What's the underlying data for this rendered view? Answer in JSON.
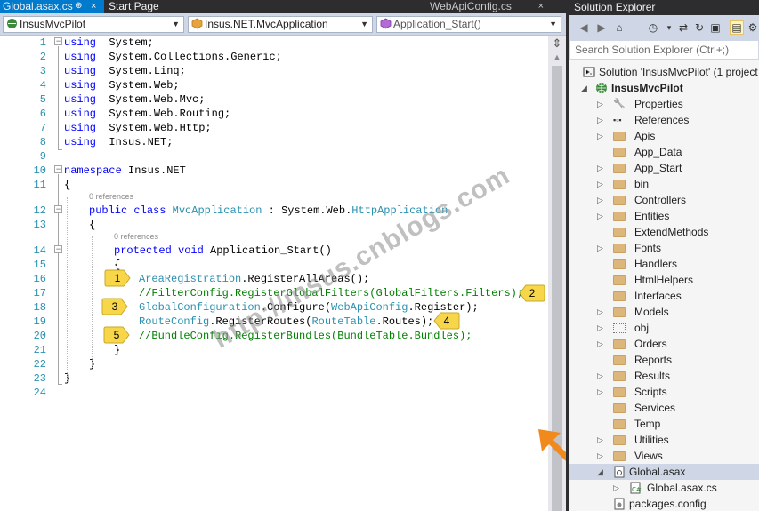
{
  "tabs": {
    "active": "Global.asax.cs",
    "active_pin": "⊕",
    "active_close": "×",
    "second": "Start Page",
    "right": "WebApiConfig.cs",
    "right_close": "×"
  },
  "nav": {
    "project": "InsusMvcPilot",
    "class": "Insus.NET.MvcApplication",
    "member": "Application_Start()"
  },
  "code": {
    "lines": [
      {
        "n": "1",
        "segs": [
          [
            "kw",
            "using"
          ],
          [
            "",
            "  System;"
          ]
        ]
      },
      {
        "n": "2",
        "segs": [
          [
            "kw",
            "using"
          ],
          [
            "",
            "  System.Collections.Generic;"
          ]
        ]
      },
      {
        "n": "3",
        "segs": [
          [
            "kw",
            "using"
          ],
          [
            "",
            "  System.Linq;"
          ]
        ]
      },
      {
        "n": "4",
        "segs": [
          [
            "kw",
            "using"
          ],
          [
            "",
            "  System.Web;"
          ]
        ]
      },
      {
        "n": "5",
        "segs": [
          [
            "kw",
            "using"
          ],
          [
            "",
            "  System.Web.Mvc;"
          ]
        ]
      },
      {
        "n": "6",
        "segs": [
          [
            "kw",
            "using"
          ],
          [
            "",
            "  System.Web.Routing;"
          ]
        ]
      },
      {
        "n": "7",
        "segs": [
          [
            "kw",
            "using"
          ],
          [
            "",
            "  System.Web.Http;"
          ]
        ]
      },
      {
        "n": "8",
        "segs": [
          [
            "kw",
            "using"
          ],
          [
            "",
            "  Insus.NET;"
          ]
        ]
      },
      {
        "n": "9",
        "segs": []
      },
      {
        "n": "10",
        "segs": [
          [
            "kw",
            "namespace"
          ],
          [
            "",
            " Insus.NET"
          ]
        ]
      },
      {
        "n": "11",
        "segs": [
          [
            "",
            "{"
          ]
        ]
      },
      {
        "n": "12",
        "segs": [
          [
            "kw",
            "public"
          ],
          [
            "",
            " "
          ],
          [
            "kw",
            "class"
          ],
          [
            "",
            " "
          ],
          [
            "ty",
            "MvcApplication"
          ],
          [
            "",
            " : System.Web."
          ],
          [
            "ty",
            "HttpApplication"
          ]
        ]
      },
      {
        "n": "13",
        "segs": [
          [
            "",
            "{"
          ]
        ]
      },
      {
        "n": "14",
        "segs": [
          [
            "kw",
            "protected"
          ],
          [
            "",
            " "
          ],
          [
            "kw",
            "void"
          ],
          [
            "",
            " Application_Start()"
          ]
        ]
      },
      {
        "n": "15",
        "segs": [
          [
            "",
            "{"
          ]
        ]
      },
      {
        "n": "16",
        "segs": [
          [
            "ty",
            "AreaRegistration"
          ],
          [
            "",
            ".RegisterAllAreas();"
          ]
        ]
      },
      {
        "n": "17",
        "segs": [
          [
            "cm",
            "//FilterConfig.RegisterGlobalFilters(GlobalFilters.Filters);"
          ]
        ]
      },
      {
        "n": "18",
        "segs": [
          [
            "ty",
            "GlobalConfiguration"
          ],
          [
            "",
            ".Configure("
          ],
          [
            "ty",
            "WebApiConfig"
          ],
          [
            "",
            ".Register);"
          ]
        ]
      },
      {
        "n": "19",
        "segs": [
          [
            "ty",
            "RouteConfig"
          ],
          [
            "",
            ".RegisterRoutes("
          ],
          [
            "ty",
            "RouteTable"
          ],
          [
            "",
            ".Routes);"
          ]
        ]
      },
      {
        "n": "20",
        "segs": [
          [
            "cm",
            "//BundleConfig.RegisterBundles(BundleTable.Bundles);"
          ]
        ]
      },
      {
        "n": "21",
        "segs": [
          [
            "",
            "}"
          ]
        ]
      },
      {
        "n": "22",
        "segs": [
          [
            "",
            "}"
          ]
        ]
      },
      {
        "n": "23",
        "segs": [
          [
            "",
            "}"
          ]
        ]
      },
      {
        "n": "24",
        "segs": []
      }
    ],
    "refs_class": "0 references",
    "refs_method": "0 references"
  },
  "badges": [
    "1",
    "2",
    "3",
    "4",
    "5"
  ],
  "watermark": "http://insus.cnblogs.com",
  "solution_explorer": {
    "title": "Solution Explorer",
    "search_placeholder": "Search Solution Explorer (Ctrl+;)",
    "solution": "Solution 'InsusMvcPilot' (1 project",
    "project": "InsusMvcPilot",
    "items": [
      {
        "label": "Properties",
        "icon": "wrench-icon",
        "expand": true
      },
      {
        "label": "References",
        "icon": "references-icon",
        "expand": true
      },
      {
        "label": "Apis",
        "icon": "folder-icon",
        "expand": true
      },
      {
        "label": "App_Data",
        "icon": "folder-icon",
        "expand": false
      },
      {
        "label": "App_Start",
        "icon": "folder-icon",
        "expand": true
      },
      {
        "label": "bin",
        "icon": "folder-icon",
        "expand": true
      },
      {
        "label": "Controllers",
        "icon": "folder-icon",
        "expand": true
      },
      {
        "label": "Entities",
        "icon": "folder-icon",
        "expand": true
      },
      {
        "label": "ExtendMethods",
        "icon": "folder-icon",
        "expand": false
      },
      {
        "label": "Fonts",
        "icon": "folder-icon",
        "expand": true
      },
      {
        "label": "Handlers",
        "icon": "folder-icon",
        "expand": false
      },
      {
        "label": "HtmlHelpers",
        "icon": "folder-icon",
        "expand": false
      },
      {
        "label": "Interfaces",
        "icon": "folder-icon",
        "expand": false
      },
      {
        "label": "Models",
        "icon": "folder-icon",
        "expand": true
      },
      {
        "label": "obj",
        "icon": "dotted-folder-icon",
        "expand": true
      },
      {
        "label": "Orders",
        "icon": "folder-icon",
        "expand": true
      },
      {
        "label": "Reports",
        "icon": "folder-icon",
        "expand": false
      },
      {
        "label": "Results",
        "icon": "folder-icon",
        "expand": true
      },
      {
        "label": "Scripts",
        "icon": "folder-icon",
        "expand": true
      },
      {
        "label": "Services",
        "icon": "folder-icon",
        "expand": false
      },
      {
        "label": "Temp",
        "icon": "folder-icon",
        "expand": false
      },
      {
        "label": "Utilities",
        "icon": "folder-icon",
        "expand": true
      },
      {
        "label": "Views",
        "icon": "folder-icon",
        "expand": true
      }
    ],
    "global_asax": "Global.asax",
    "global_asax_cs": "Global.asax.cs",
    "packages_config": "packages.config"
  }
}
